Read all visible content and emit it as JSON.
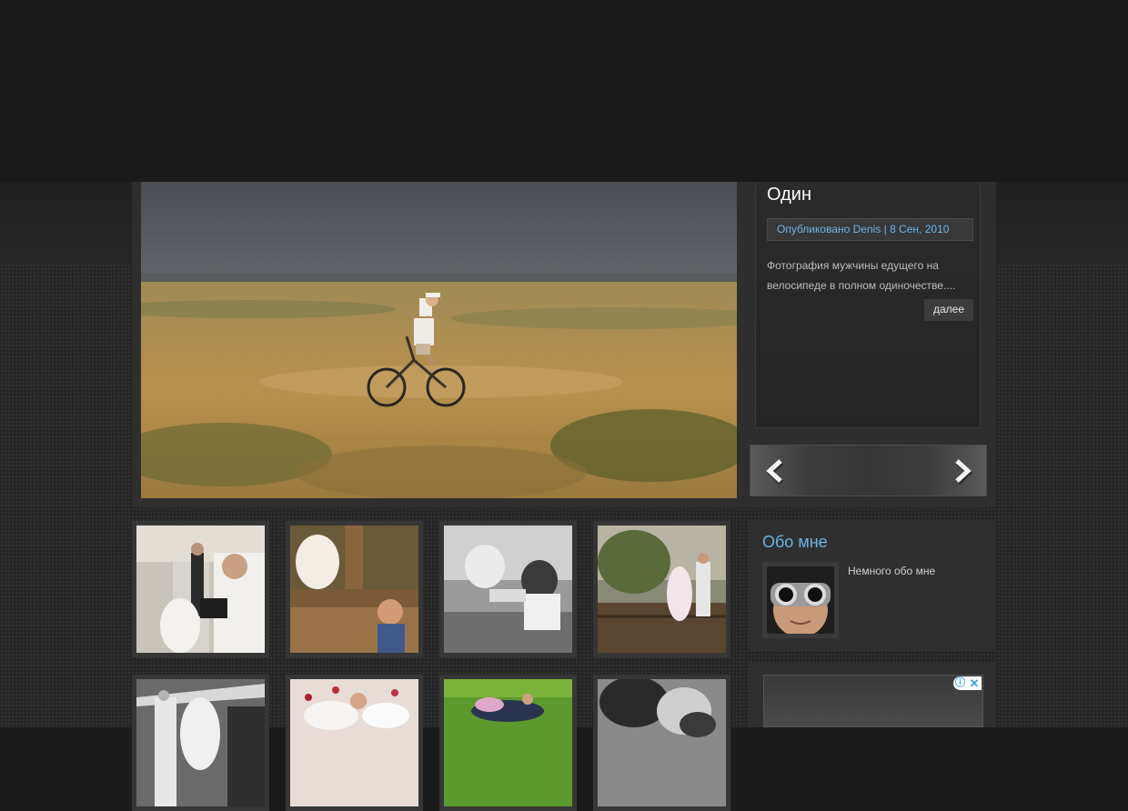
{
  "featured_post": {
    "title": "Один",
    "meta": "Опубликовано Denis | 8 Сен, 2010",
    "excerpt": "Фотография мужчины едущего на велосипеде в полном одиночестве....",
    "more_label": "далее"
  },
  "slider_nav": {
    "prev_icon": "chevron-left-icon",
    "next_icon": "chevron-right-icon"
  },
  "gallery": {
    "thumbnails": [
      {
        "subject": "photographer-with-wedding-couple"
      },
      {
        "subject": "bride-and-groom-at-well"
      },
      {
        "subject": "arm-wrestling-couple-bw"
      },
      {
        "subject": "couple-on-bridge"
      },
      {
        "subject": "couple-under-canopy-bw"
      },
      {
        "subject": "couple-lying-with-rose-petals"
      },
      {
        "subject": "couple-lying-on-grass"
      },
      {
        "subject": "couple-kissing-bw"
      }
    ]
  },
  "sidebar": {
    "about_title": "Обо мне",
    "about_text": "Немного обо мне",
    "avatar_icon": "avatar-goggles-photo"
  },
  "ad": {
    "info_icon": "ⓘ",
    "close_icon": "✕"
  },
  "colors": {
    "accent_blue": "#6ab6e8",
    "background": "#1b1b1b",
    "panel": "#2e2e2e"
  }
}
